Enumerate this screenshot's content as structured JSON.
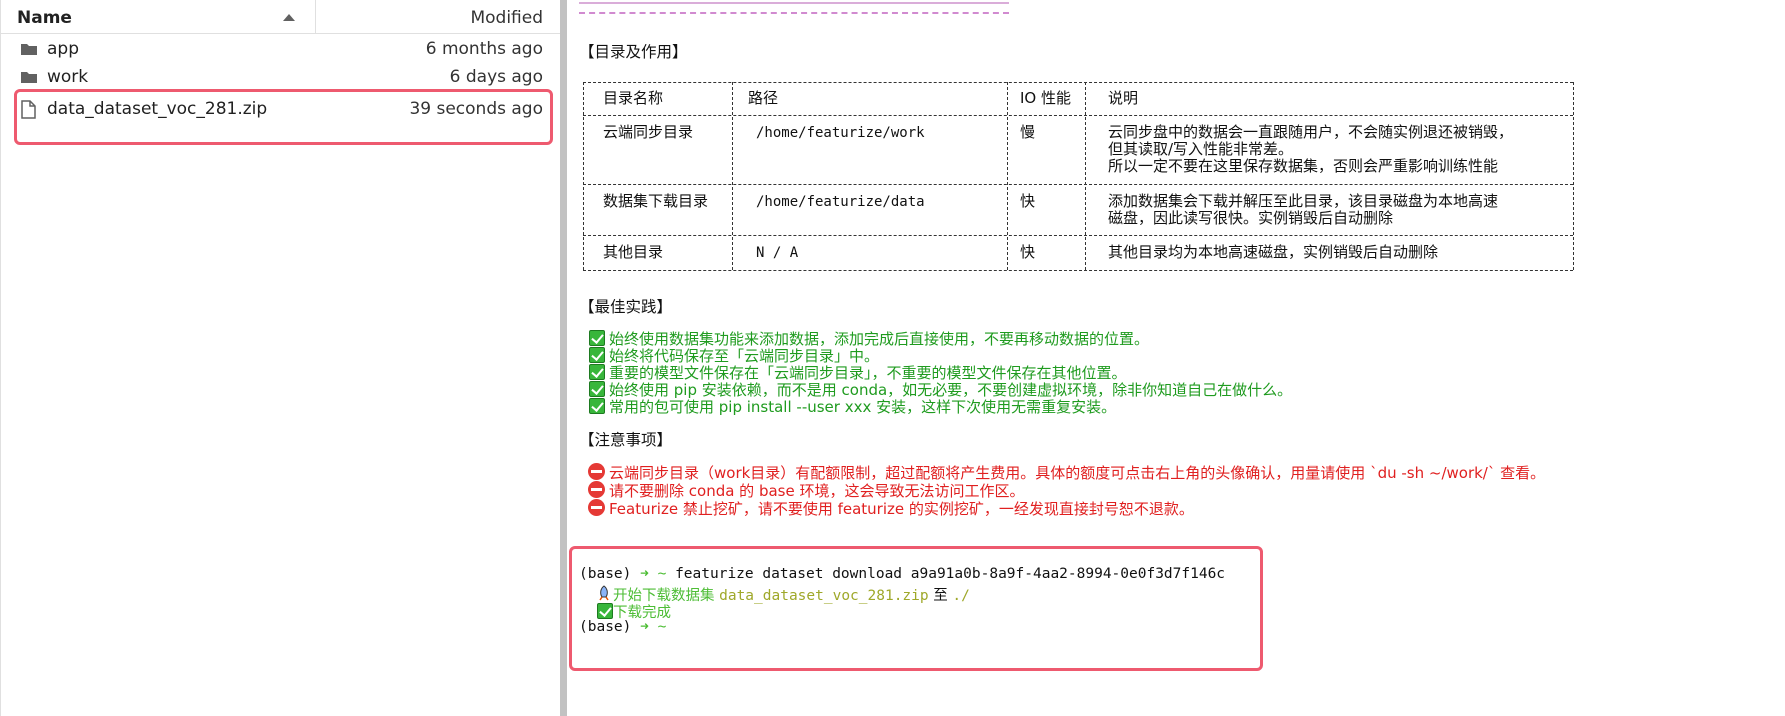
{
  "file_browser": {
    "header": {
      "name": "Name",
      "modified": "Modified"
    },
    "files": [
      {
        "name": "app",
        "modified": "6 months ago",
        "icon": "folder-icon"
      },
      {
        "name": "work",
        "modified": "6 days ago",
        "icon": "folder-icon"
      },
      {
        "name": "data_dataset_voc_281.zip",
        "modified": "39 seconds ago",
        "icon": "file-icon"
      }
    ]
  },
  "terminal": {
    "section_dirs": "【目录及作用】",
    "table": {
      "headers": [
        "目录名称",
        "路径",
        "IO 性能",
        "说明"
      ],
      "rows": [
        {
          "name": "云端同步目录",
          "path": "/home/featurize/work",
          "io": "慢",
          "desc": [
            "云同步盘中的数据会一直跟随用户，不会随实例退还被销毁，",
            "但其读取/写入性能非常差。",
            "所以一定不要在这里保存数据集，否则会严重影响训练性能"
          ]
        },
        {
          "name": "数据集下载目录",
          "path": "/home/featurize/data",
          "io": "快",
          "desc": [
            "添加数据集会下载并解压至此目录，该目录磁盘为本地高速",
            "磁盘，因此读写很快。实例销毁后自动删除"
          ]
        },
        {
          "name": "其他目录",
          "path": "N / A",
          "io": "快",
          "desc": [
            "其他目录均为本地高速磁盘，实例销毁后自动删除"
          ]
        }
      ]
    },
    "section_best": "【最佳实践】",
    "best_practices": [
      "始终使用数据集功能来添加数据，添加完成后直接使用，不要再移动数据的位置。",
      "始终将代码保存至「云端同步目录」中。",
      "重要的模型文件保存在「云端同步目录」，不重要的模型文件保存在其他位置。",
      "始终使用 pip 安装依赖，而不是用 conda，如无必要，不要创建虚拟环境，除非你知道自己在做什么。",
      "常用的包可使用 pip install --user xxx 安装，这样下次使用无需重复安装。"
    ],
    "section_notes": "【注意事项】",
    "notes": [
      "云端同步目录（work目录）有配额限制，超过配额将产生费用。具体的额度可点击右上角的头像确认，用量请使用 `du -sh ~/work/` 查看。",
      "请不要删除 conda 的 base 环境，这会导致无法访问工作区。",
      "Featurize 禁止挖矿，请不要使用 featurize 的实例挖矿，一经发现直接封号恕不退款。"
    ],
    "shell": {
      "env": "(base)",
      "arrow": "➜",
      "tilde": "~",
      "command": "featurize dataset download a9a91a0b-8a9f-4aa2-8994-0e0f3d7f146c",
      "start_label": "开始下载数据集",
      "filename": "data_dataset_voc_281.zip",
      "to_word": "至",
      "dest": "./",
      "done_label": "下载完成"
    }
  },
  "colors": {
    "highlight": "#ee5a6f",
    "ok_green": "#1f9b1f",
    "warn_red": "#e02020",
    "prompt_green": "#4dbd35"
  }
}
